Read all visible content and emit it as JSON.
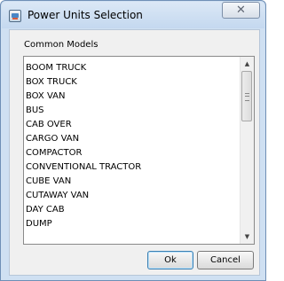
{
  "window": {
    "title": "Power Units Selection",
    "close_glyph": "✕",
    "icon": "app-window-icon"
  },
  "group": {
    "label": "Common Models"
  },
  "list": {
    "items": [
      "BOOM TRUCK",
      "BOX TRUCK",
      "BOX VAN",
      "BUS",
      "CAB OVER",
      "CARGO VAN",
      "COMPACTOR",
      "CONVENTIONAL TRACTOR",
      "CUBE VAN",
      "CUTAWAY VAN",
      "DAY CAB",
      "DUMP"
    ]
  },
  "scrollbar": {
    "up_glyph": "▲",
    "down_glyph": "▼"
  },
  "buttons": {
    "ok": "Ok",
    "cancel": "Cancel"
  },
  "colors": {
    "title_bar": "#c4d8ef",
    "client_bg": "#f0f0f0",
    "ok_focus_border": "#3c7fb1"
  }
}
